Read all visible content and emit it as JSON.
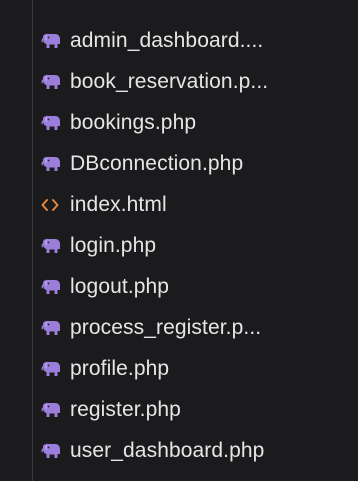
{
  "colors": {
    "background": "#1b1b1d",
    "text": "#e6e6e6",
    "php_icon": "#9b7ed9",
    "html_icon": "#e8863a",
    "indent_guide": "#3a3a3c"
  },
  "files": [
    {
      "label": "admin_dashboard....",
      "icon": "php-elephant-icon"
    },
    {
      "label": "book_reservation.p...",
      "icon": "php-elephant-icon"
    },
    {
      "label": "bookings.php",
      "icon": "php-elephant-icon"
    },
    {
      "label": "DBconnection.php",
      "icon": "php-elephant-icon"
    },
    {
      "label": "index.html",
      "icon": "html-brackets-icon"
    },
    {
      "label": "login.php",
      "icon": "php-elephant-icon"
    },
    {
      "label": "logout.php",
      "icon": "php-elephant-icon"
    },
    {
      "label": "process_register.p...",
      "icon": "php-elephant-icon"
    },
    {
      "label": "profile.php",
      "icon": "php-elephant-icon"
    },
    {
      "label": "register.php",
      "icon": "php-elephant-icon"
    },
    {
      "label": "user_dashboard.php",
      "icon": "php-elephant-icon"
    }
  ]
}
